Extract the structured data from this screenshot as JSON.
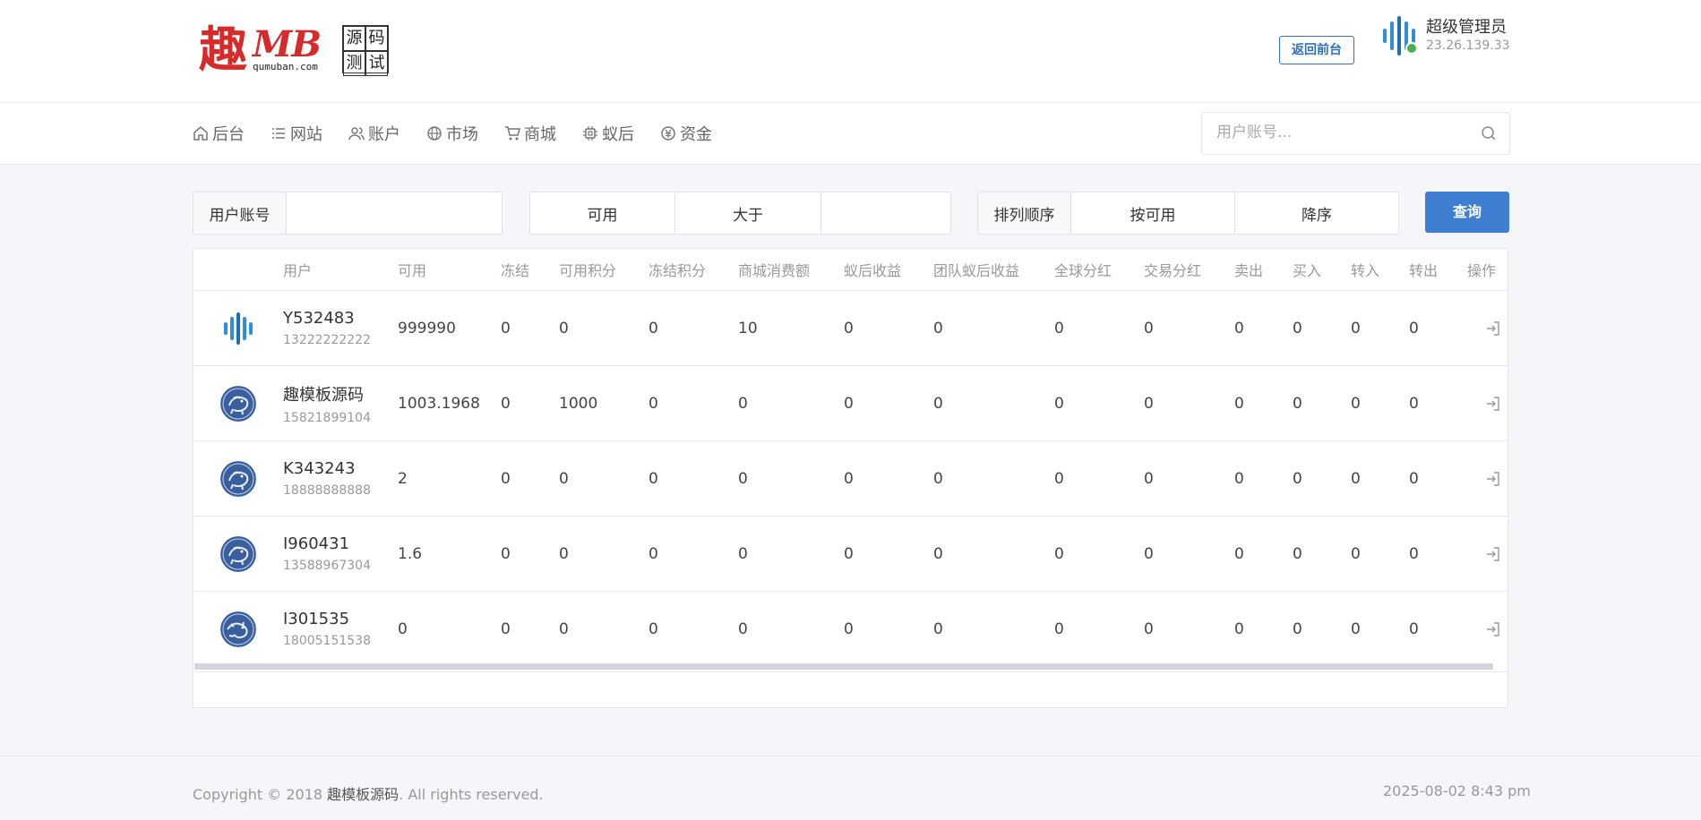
{
  "logo": {
    "char": "趣",
    "mark": "MB",
    "url": "qumuban.com",
    "box": [
      "源",
      "码",
      "测",
      "试"
    ]
  },
  "header": {
    "back_button": "返回前台",
    "admin_name": "超级管理员",
    "admin_ip": "23.26.139.33",
    "online_color": "#4caf50"
  },
  "nav": {
    "items": [
      {
        "label": "后台",
        "icon": "home-icon"
      },
      {
        "label": "网站",
        "icon": "list-icon"
      },
      {
        "label": "账户",
        "icon": "users-icon"
      },
      {
        "label": "市场",
        "icon": "globe-icon"
      },
      {
        "label": "商城",
        "icon": "cart-icon"
      },
      {
        "label": "蚁后",
        "icon": "chip-icon"
      },
      {
        "label": "资金",
        "icon": "money-icon"
      }
    ],
    "search_placeholder": "用户账号..."
  },
  "filters": {
    "account_label": "用户账号",
    "account_value": "",
    "field_select": "可用",
    "compare_select": "大于",
    "amount_value": "",
    "sort_label": "排列顺序",
    "sort_field": "按可用",
    "sort_order": "降序",
    "query_button": "查询"
  },
  "table": {
    "columns": [
      "",
      "用户",
      "可用",
      "冻结",
      "可用积分",
      "冻结积分",
      "商城消费额",
      "蚁后收益",
      "团队蚁后收益",
      "全球分红",
      "交易分红",
      "卖出",
      "买入",
      "转入",
      "转出",
      "操作"
    ],
    "rows": [
      {
        "avatar": "bars-logo",
        "name": "Y532483",
        "phone": "13222222222",
        "values": [
          "999990",
          "0",
          "0",
          "0",
          "10",
          "0",
          "0",
          "0",
          "0",
          "0",
          "0",
          "0",
          "0"
        ]
      },
      {
        "avatar": "lion-medallion",
        "name": "趣模板源码",
        "phone": "15821899104",
        "values": [
          "1003.1968",
          "0",
          "1000",
          "0",
          "0",
          "0",
          "0",
          "0",
          "0",
          "0",
          "0",
          "0",
          "0"
        ]
      },
      {
        "avatar": "lion-medallion",
        "name": "K343243",
        "phone": "18888888888",
        "values": [
          "2",
          "0",
          "0",
          "0",
          "0",
          "0",
          "0",
          "0",
          "0",
          "0",
          "0",
          "0",
          "0"
        ]
      },
      {
        "avatar": "lion-medallion",
        "name": "I960431",
        "phone": "13588967304",
        "values": [
          "1.6",
          "0",
          "0",
          "0",
          "0",
          "0",
          "0",
          "0",
          "0",
          "0",
          "0",
          "0",
          "0"
        ]
      },
      {
        "avatar": "dragon-medallion",
        "name": "I301535",
        "phone": "18005151538",
        "values": [
          "0",
          "0",
          "0",
          "0",
          "0",
          "0",
          "0",
          "0",
          "0",
          "0",
          "0",
          "0",
          "0"
        ]
      }
    ]
  },
  "footer": {
    "copyright_prefix": "Copyright © 2018 ",
    "copyright_brand": "趣模板源码",
    "copyright_suffix": ". All rights reserved.",
    "datetime": "2025-08-02 8:43 pm"
  },
  "colors": {
    "primary": "#3f7fd1",
    "logo_red": "#d62b2b",
    "avatar_blue": "#3a5f9e"
  }
}
